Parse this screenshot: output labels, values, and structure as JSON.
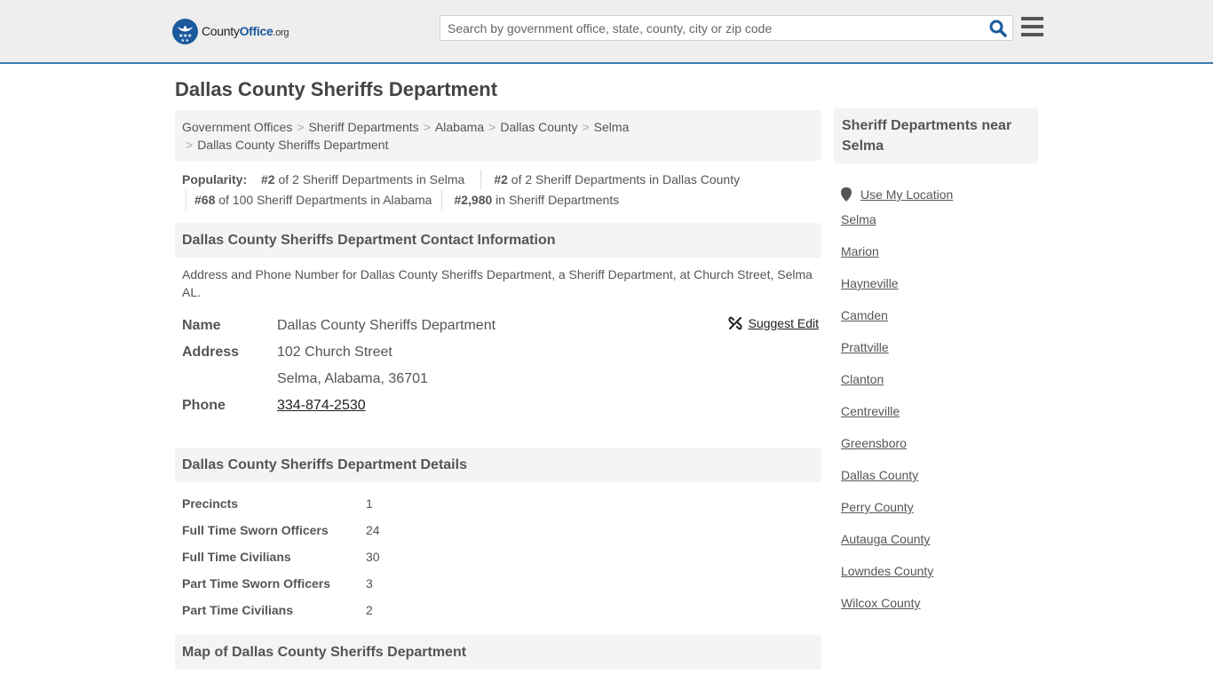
{
  "site": {
    "logo_main": "County",
    "logo_accent": "Office",
    "logo_tld": ".org",
    "brand_color": "#1b5a9c",
    "accent_border_color": "#3b7bb0"
  },
  "search": {
    "placeholder": "Search by government office, state, county, city or zip code",
    "value": "",
    "icon": "search-icon"
  },
  "menu": {
    "icon": "hamburger-menu-icon"
  },
  "page": {
    "title": "Dallas County Sheriffs Department"
  },
  "breadcrumb": {
    "items": [
      "Government Offices",
      "Sheriff Departments",
      "Alabama",
      "Dallas County",
      "Selma",
      "Dallas County Sheriffs Department"
    ],
    "separator": ">"
  },
  "popularity": {
    "label": "Popularity:",
    "items": [
      {
        "rank": "#2",
        "text": " of 2 Sheriff Departments in Selma"
      },
      {
        "rank": "#2",
        "text": " of 2 Sheriff Departments in Dallas County"
      },
      {
        "rank": "#68",
        "text": " of 100 Sheriff Departments in Alabama"
      },
      {
        "rank": "#2,980",
        "text": " in Sheriff Departments"
      }
    ]
  },
  "contact": {
    "heading": "Dallas County Sheriffs Department Contact Information",
    "description": "Address and Phone Number for Dallas County Sheriffs Department, a Sheriff Department, at Church Street, Selma AL.",
    "suggest_edit": "Suggest Edit",
    "rows": {
      "name_label": "Name",
      "name_value": "Dallas County Sheriffs Department",
      "address_label": "Address",
      "address_line1": "102 Church Street",
      "address_line2": "Selma, Alabama, 36701",
      "phone_label": "Phone",
      "phone_value": "334-874-2530"
    }
  },
  "details": {
    "heading": "Dallas County Sheriffs Department Details",
    "rows": [
      {
        "label": "Precincts",
        "value": "1"
      },
      {
        "label": "Full Time Sworn Officers",
        "value": "24"
      },
      {
        "label": "Full Time Civilians",
        "value": "30"
      },
      {
        "label": "Part Time Sworn Officers",
        "value": "3"
      },
      {
        "label": "Part Time Civilians",
        "value": "2"
      }
    ]
  },
  "map": {
    "heading": "Map of Dallas County Sheriffs Department"
  },
  "sidebar": {
    "heading": "Sheriff Departments near Selma",
    "use_location": "Use My Location",
    "links": [
      "Selma",
      "Marion",
      "Hayneville",
      "Camden",
      "Prattville",
      "Clanton",
      "Centreville",
      "Greensboro",
      "Dallas County",
      "Perry County",
      "Autauga County",
      "Lowndes County",
      "Wilcox County"
    ]
  }
}
